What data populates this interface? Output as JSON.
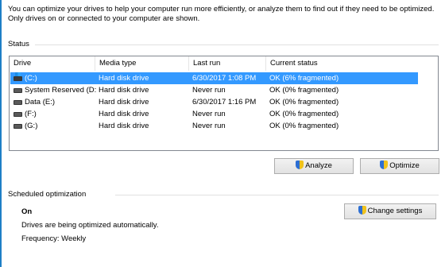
{
  "intro_text": "You can optimize your drives to help your computer run more efficiently, or analyze them to find out if they need to be optimized. Only drives on or connected to your computer are shown.",
  "status": {
    "label": "Status",
    "columns": [
      "Drive",
      "Media type",
      "Last run",
      "Current status"
    ],
    "rows": [
      {
        "drive": "(C:)",
        "media": "Hard disk drive",
        "last_run": "6/30/2017 1:08 PM",
        "status": "OK (6% fragmented)",
        "icon": "system-drive-icon",
        "selected": true
      },
      {
        "drive": "System Reserved (D:)",
        "media": "Hard disk drive",
        "last_run": "Never run",
        "status": "OK (0% fragmented)",
        "icon": "drive-icon",
        "selected": false
      },
      {
        "drive": "Data (E:)",
        "media": "Hard disk drive",
        "last_run": "6/30/2017 1:16 PM",
        "status": "OK (0% fragmented)",
        "icon": "drive-icon",
        "selected": false
      },
      {
        "drive": "(F:)",
        "media": "Hard disk drive",
        "last_run": "Never run",
        "status": "OK (0% fragmented)",
        "icon": "drive-icon",
        "selected": false
      },
      {
        "drive": "(G:)",
        "media": "Hard disk drive",
        "last_run": "Never run",
        "status": "OK (0% fragmented)",
        "icon": "drive-icon",
        "selected": false
      }
    ]
  },
  "buttons": {
    "analyze": "Analyze",
    "optimize": "Optimize",
    "change_settings": "Change settings"
  },
  "scheduled": {
    "label": "Scheduled optimization",
    "state": "On",
    "description": "Drives are being optimized automatically.",
    "frequency": "Frequency: Weekly"
  },
  "colors": {
    "selection": "#3399ff",
    "accent_edge": "#1e7fc6"
  }
}
